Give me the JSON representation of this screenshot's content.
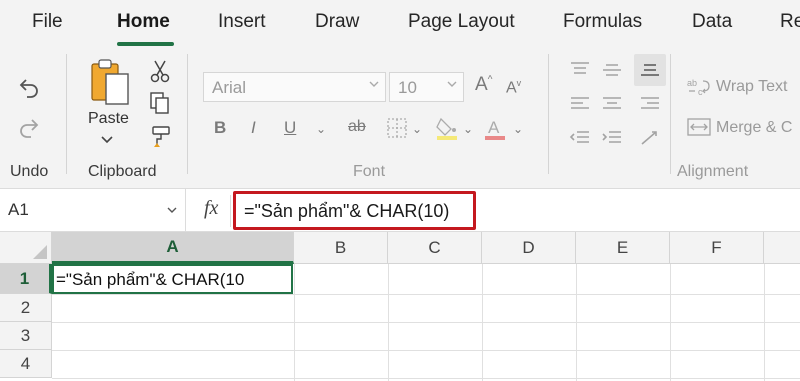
{
  "tabs": [
    "File",
    "Home",
    "Insert",
    "Draw",
    "Page Layout",
    "Formulas",
    "Data",
    "Re"
  ],
  "active_tab": "Home",
  "ribbon": {
    "undo_group_label": "Undo",
    "clipboard": {
      "paste_label": "Paste",
      "group_label": "Clipboard"
    },
    "font": {
      "name": "Arial",
      "size": "10",
      "group_label": "Font"
    },
    "alignment": {
      "wrap_text_label": "Wrap Text",
      "merge_label": "Merge & C",
      "group_label": "Alignment"
    }
  },
  "formula_bar": {
    "name_box": "A1",
    "fx_label": "fx",
    "formula": "=\"Sản phẩm\"& CHAR(10)"
  },
  "sheet": {
    "columns": [
      "A",
      "B",
      "C",
      "D",
      "E",
      "F"
    ],
    "rows": [
      "1",
      "2",
      "3",
      "4"
    ],
    "selected_cell": "A1",
    "cells": {
      "A1": "=\"Sản phẩm\"& CHAR(10"
    }
  },
  "colors": {
    "accent": "#217346",
    "highlight_border": "#c4181f"
  }
}
